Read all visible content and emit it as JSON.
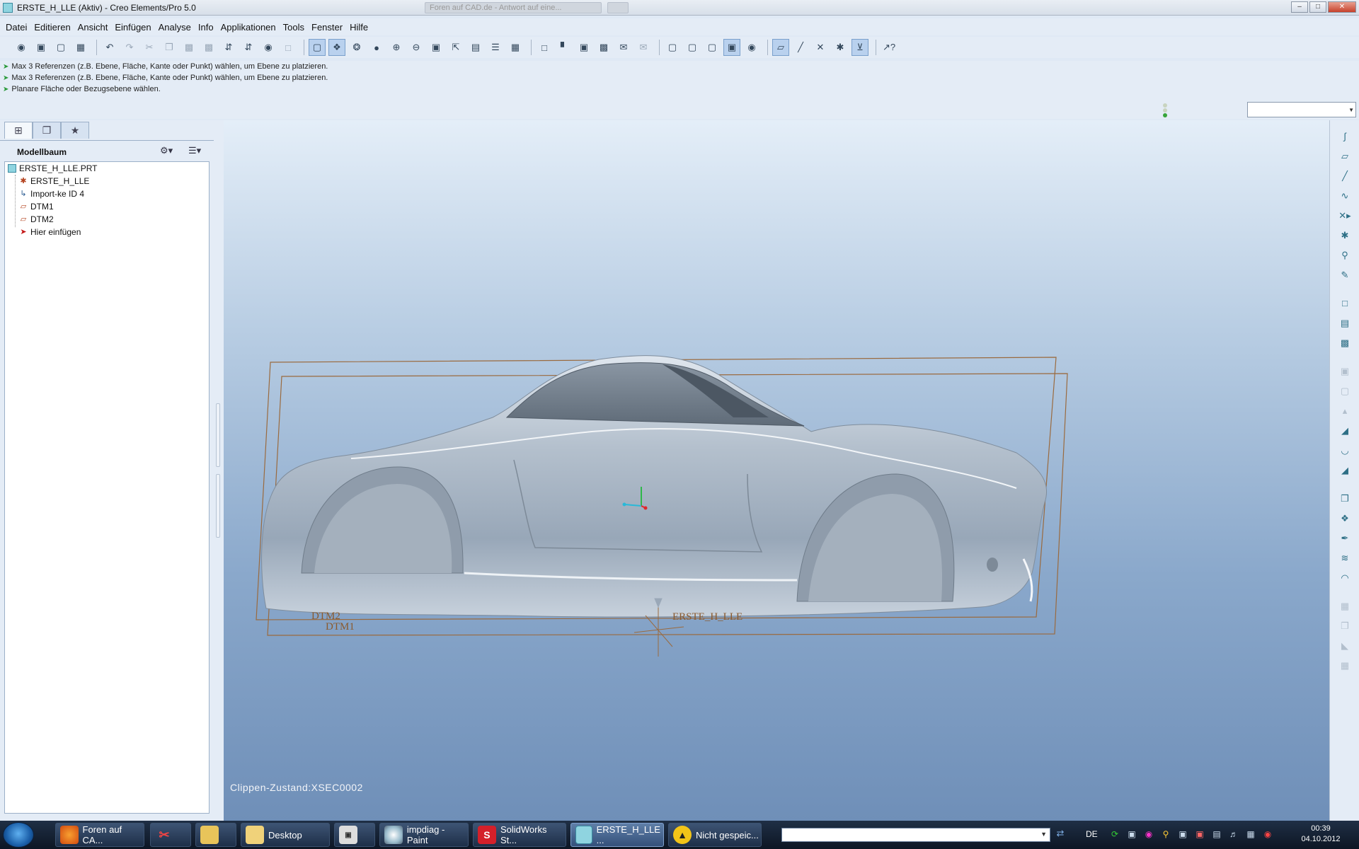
{
  "window": {
    "title": "ERSTE_H_LLE (Aktiv) - Creo Elements/Pro 5.0",
    "background_tabs": [
      "Foren auf CAD.de - Antwort auf eine...",
      ""
    ]
  },
  "menu": [
    "Datei",
    "Editieren",
    "Ansicht",
    "Einfügen",
    "Analyse",
    "Info",
    "Applikationen",
    "Tools",
    "Fenster",
    "Hilfe"
  ],
  "messages": [
    "Max 3 Referenzen (z.B. Ebene, Fläche, Kante oder Punkt) wählen, um Ebene zu platzieren.",
    "Max 3 Referenzen (z.B. Ebene, Fläche, Kante oder Punkt) wählen, um Ebene zu platzieren.",
    "Planare Fläche oder Bezugsebene wählen."
  ],
  "filter": {
    "value": ""
  },
  "panel": {
    "title": "Modellbaum",
    "tree": [
      {
        "label": "ERSTE_H_LLE.PRT",
        "icon": "part-icon"
      },
      {
        "label": "ERSTE_H_LLE",
        "icon": "csys-icon"
      },
      {
        "label": "Import-ke ID 4",
        "icon": "import-feature-icon"
      },
      {
        "label": "DTM1",
        "icon": "datum-plane-icon"
      },
      {
        "label": "DTM2",
        "icon": "datum-plane-icon"
      },
      {
        "label": "Hier einfügen",
        "icon": "insert-here-arrow-icon"
      }
    ]
  },
  "viewport": {
    "clip_status": "Clippen-Zustand:XSEC0002",
    "datum_labels": {
      "dtm1": "DTM1",
      "dtm2": "DTM2",
      "csys": "ERSTE_H_LLE"
    }
  },
  "taskbar": {
    "tasks": [
      {
        "label": "Foren auf CA...",
        "icon": "firefox-icon"
      },
      {
        "label": "",
        "icon": "snipping-tool-icon"
      },
      {
        "label": "",
        "icon": "explorer-icon"
      },
      {
        "label": "Desktop",
        "icon": "folder-icon"
      },
      {
        "label": "",
        "icon": "application-icon"
      },
      {
        "label": "impdiag - Paint",
        "icon": "paint-icon"
      },
      {
        "label": "SolidWorks St...",
        "icon": "solidworks-icon"
      },
      {
        "label": "ERSTE_H_LLE ...",
        "icon": "creo-icon"
      },
      {
        "label": "Nicht gespeic...",
        "icon": "warning-app-icon"
      }
    ],
    "search_value": "",
    "language": "DE",
    "clock_time": "00:39",
    "clock_date": "04.10.2012"
  },
  "colors": {
    "datum": "#9a6a3e",
    "model": "#a9b6c4",
    "viewport_top": "#e4eef8",
    "viewport_bottom": "#6f8fb8"
  }
}
